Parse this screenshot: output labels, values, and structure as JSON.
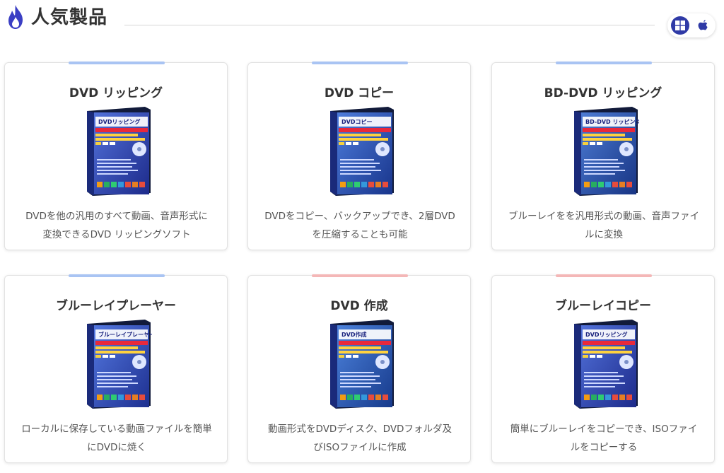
{
  "header": {
    "title": "人気製品",
    "os": [
      {
        "label": "Windows",
        "icon": "windows-icon",
        "active": true
      },
      {
        "label": "Mac",
        "icon": "apple-icon",
        "active": false
      }
    ]
  },
  "colors": {
    "accent_blue": "#a9c4f3",
    "accent_red": "#f4b7b7",
    "active_os": "#2f3aa6"
  },
  "products": [
    {
      "name": "DVD リッピング",
      "box_title": "DVDリッピング",
      "desc1": "DVDを他の汎用のすべて動画、音声形式に",
      "desc2": "変換できるDVD リッピングソフト",
      "accent": "#a9c4f3",
      "box_color": "#2a3bb5"
    },
    {
      "name": "DVD コピー",
      "box_title": "DVDコピー",
      "desc1": "DVDをコピー、バックアップでき、2層DVD",
      "desc2": "を圧縮することも可能",
      "accent": "#a9c4f3",
      "box_color": "#2150b8"
    },
    {
      "name": "BD-DVD リッピング",
      "box_title": "BD-DVD リッピング",
      "desc1": "ブルーレイをを汎用形式の動画、音声ファイ",
      "desc2": "ルに変換",
      "accent": "#a9c4f3",
      "box_color": "#1f4fa8"
    },
    {
      "name": "ブルーレイプレーヤー",
      "box_title": "ブルーレイプレーヤー",
      "desc1": "ローカルに保存している動画ファイルを簡単",
      "desc2": "にDVDに焼く",
      "accent": "#a9c4f3",
      "box_color": "#2c46c0"
    },
    {
      "name": "DVD 作成",
      "box_title": "DVD作成",
      "desc1": "動画形式をDVDディスク、DVDフォルダ及",
      "desc2": "びISOファイルに作成",
      "accent": "#f4b7b7",
      "box_color": "#1e5bb8"
    },
    {
      "name": "ブルーレイコピー",
      "box_title": "DVDリッピング",
      "desc1": "簡単にブルーレイをコピーでき、ISOファイ",
      "desc2": "ルをコピーする",
      "accent": "#f4b7b7",
      "box_color": "#2a3bb5"
    }
  ]
}
